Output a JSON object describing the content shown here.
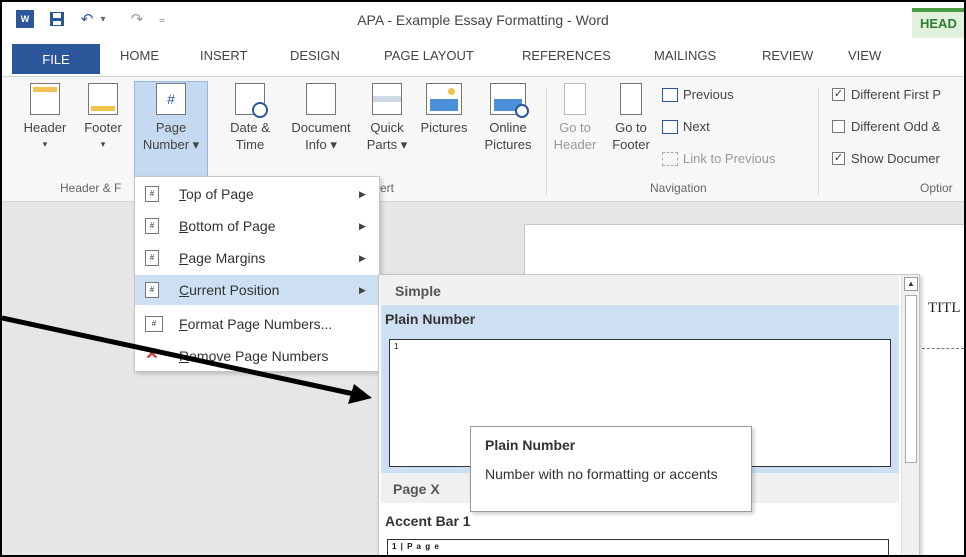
{
  "window": {
    "title": "APA - Example Essay Formatting - Word",
    "context_tab": "HEAD",
    "word_logo": "W",
    "qat": {
      "undo": "↶",
      "undo_arrow": "▾",
      "redo": "↷",
      "more": "₌"
    }
  },
  "tabs": [
    "FILE",
    "HOME",
    "INSERT",
    "DESIGN",
    "PAGE LAYOUT",
    "REFERENCES",
    "MAILINGS",
    "REVIEW",
    "VIEW"
  ],
  "ribbon": {
    "header_btn": {
      "line1": "Header",
      "line2": "▾"
    },
    "footer_btn": {
      "line1": "Footer",
      "line2": "▾"
    },
    "page_number_btn": {
      "line1": "Page",
      "line2": "Number ▾"
    },
    "date_time_btn": {
      "line1": "Date &",
      "line2": "Time"
    },
    "doc_info_btn": {
      "line1": "Document",
      "line2": "Info ▾"
    },
    "quick_parts_btn": {
      "line1": "Quick",
      "line2": "Parts ▾"
    },
    "pictures_btn": {
      "line1": "Pictures",
      "line2": ""
    },
    "online_pictures_btn": {
      "line1": "Online",
      "line2": "Pictures"
    },
    "goto_header_btn": {
      "line1": "Go to",
      "line2": "Header"
    },
    "goto_footer_btn": {
      "line1": "Go to",
      "line2": "Footer"
    },
    "previous": "Previous",
    "next": "Next",
    "link_previous": "Link to Previous",
    "group_header_footer": "Header & F",
    "group_insert": "ert",
    "group_navigation": "Navigation",
    "group_options": "Optior",
    "options": [
      {
        "label": "Different First P",
        "checked": true
      },
      {
        "label": "Different Odd &",
        "checked": false
      },
      {
        "label": "Show Documer",
        "checked": true
      }
    ]
  },
  "menu": {
    "items": [
      {
        "label": "Top of Page",
        "mnemonic": "T",
        "rest": "op of Page",
        "has_submenu": true,
        "highlighted": false
      },
      {
        "label": "Bottom of Page",
        "mnemonic": "B",
        "rest": "ottom of Page",
        "has_submenu": true,
        "highlighted": false
      },
      {
        "label": "Page Margins",
        "mnemonic": "P",
        "rest": "age Margins",
        "has_submenu": true,
        "highlighted": false
      },
      {
        "label": "Current Position",
        "mnemonic": "C",
        "rest": "urrent Position",
        "has_submenu": true,
        "highlighted": true
      },
      {
        "label": "Format Page Numbers...",
        "mnemonic": "F",
        "rest": "ormat Page Numbers...",
        "has_submenu": false,
        "highlighted": false
      },
      {
        "label": "Remove Page Numbers",
        "mnemonic": "R",
        "rest": "emove Page Numbers",
        "has_submenu": false,
        "highlighted": false
      }
    ],
    "arrow": "▶"
  },
  "gallery": {
    "section": "Simple",
    "item1_name": "Plain Number",
    "item1_preview": "1",
    "subsection": "Page X",
    "item2_name": "Accent Bar 1",
    "item2_preview": "1 | P a g e",
    "scroll_up": "▲"
  },
  "tooltip": {
    "title": "Plain Number",
    "description": "Number with no formatting or accents"
  },
  "document": {
    "visible_title_fragment": "TITL"
  },
  "colors": {
    "word_blue": "#2b579a",
    "menu_highlight": "#cde0f3",
    "header_context_green": "#4a9e42",
    "annotation_arrow": "#000000"
  }
}
